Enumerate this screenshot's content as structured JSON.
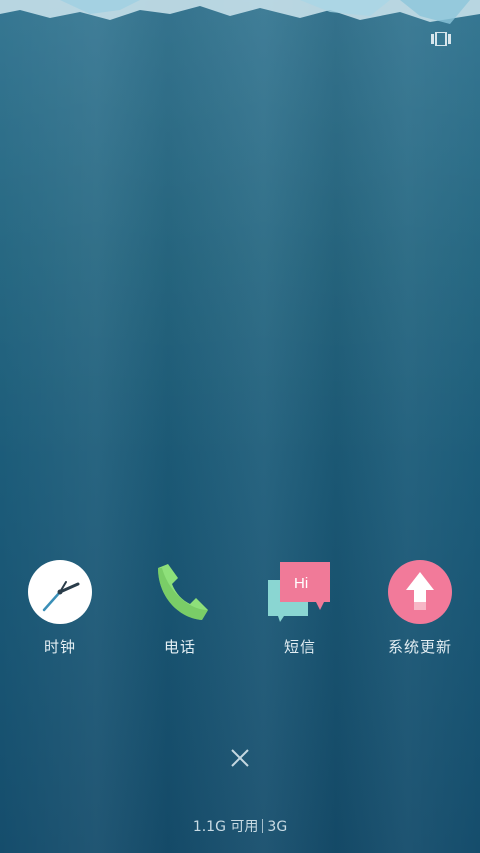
{
  "status": {
    "recents_icon": "recents-card-icon"
  },
  "apps": [
    {
      "label": "时钟",
      "icon": "clock-icon"
    },
    {
      "label": "电话",
      "icon": "phone-icon"
    },
    {
      "label": "短信",
      "icon": "sms-icon"
    },
    {
      "label": "系统更新",
      "icon": "system-update-icon"
    }
  ],
  "sms_icon_text": "Hi",
  "close_icon": "close-icon",
  "memory": {
    "available": "1.1G 可用",
    "network": "3G"
  },
  "colors": {
    "background": "#1f6080",
    "clock_bg": "#ffffff",
    "phone": "#8ee07a",
    "sms_pink": "#f07a98",
    "sms_teal": "#8ad6d2",
    "update_pink": "#f27a9a"
  }
}
